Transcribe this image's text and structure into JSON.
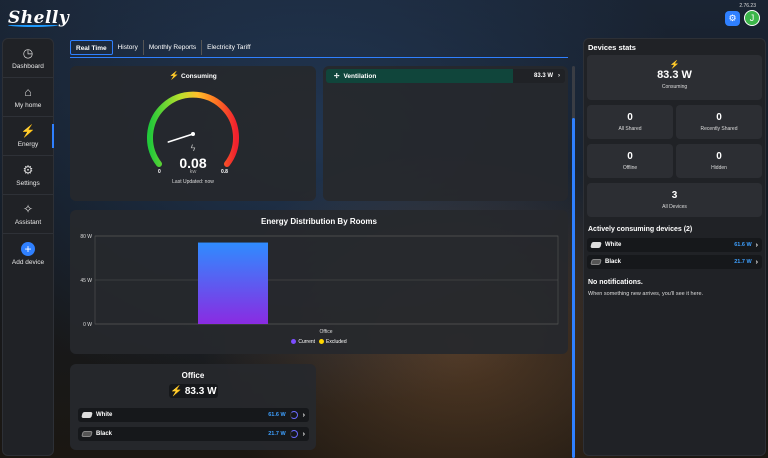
{
  "app": {
    "logo": "Shelly",
    "version": "2.76.23"
  },
  "topbar": {
    "avatar_initial": "J"
  },
  "sidebar": {
    "items": [
      {
        "label": "Dashboard",
        "icon": "gauge-icon"
      },
      {
        "label": "My home",
        "icon": "home-icon"
      },
      {
        "label": "Energy",
        "icon": "bolt-icon"
      },
      {
        "label": "Settings",
        "icon": "gear-icon"
      },
      {
        "label": "Assistant",
        "icon": "sparkle-icon"
      },
      {
        "label": "Add device",
        "icon": "plus-icon"
      }
    ]
  },
  "tabs": [
    "Real Time",
    "History",
    "Monthly Reports",
    "Electricity Tariff"
  ],
  "consuming": {
    "title": "Consuming",
    "value": "0.08",
    "unit": "kw",
    "min": "0",
    "max": "0.8",
    "updated": "Last Updated: now",
    "fraction": 0.1
  },
  "ventilation": {
    "label": "Ventilation",
    "power": "83.3 W"
  },
  "chart": {
    "title": "Energy Distribution By Rooms",
    "ticks": [
      "80 W",
      "45 W",
      "0 W"
    ],
    "legend": [
      "Current",
      "Excluded"
    ],
    "colors": {
      "current": "#7c4dff",
      "excluded": "#ffd600"
    }
  },
  "chart_data": {
    "type": "bar",
    "title": "Energy Distribution By Rooms",
    "categories": [
      "Office"
    ],
    "series": [
      {
        "name": "Current",
        "values": [
          83.3
        ]
      }
    ],
    "yticks": [
      0,
      45,
      90
    ],
    "ylim": [
      0,
      90
    ],
    "legend": [
      "Current",
      "Excluded"
    ]
  },
  "office": {
    "title": "Office",
    "power": "83.3 W",
    "devices": [
      {
        "name": "White",
        "power": "61.6 W"
      },
      {
        "name": "Black",
        "power": "21.7 W"
      }
    ]
  },
  "stats": {
    "title": "Devices stats",
    "consuming_value": "83.3 W",
    "consuming_label": "Consuming",
    "all_shared": "0",
    "all_shared_label": "All Shared",
    "recent_shared": "0",
    "recent_shared_label": "Recently Shared",
    "offline": "0",
    "offline_label": "Offline",
    "hidden": "0",
    "hidden_label": "Hidden",
    "all_devices": "3",
    "all_devices_label": "All Devices",
    "active_title": "Actively consuming devices (2)",
    "active": [
      {
        "name": "White",
        "power": "61.6 W"
      },
      {
        "name": "Black",
        "power": "21.7 W"
      }
    ],
    "no_notif": "No notifications.",
    "no_notif_sub": "When something new arrives, you'll see it here."
  }
}
